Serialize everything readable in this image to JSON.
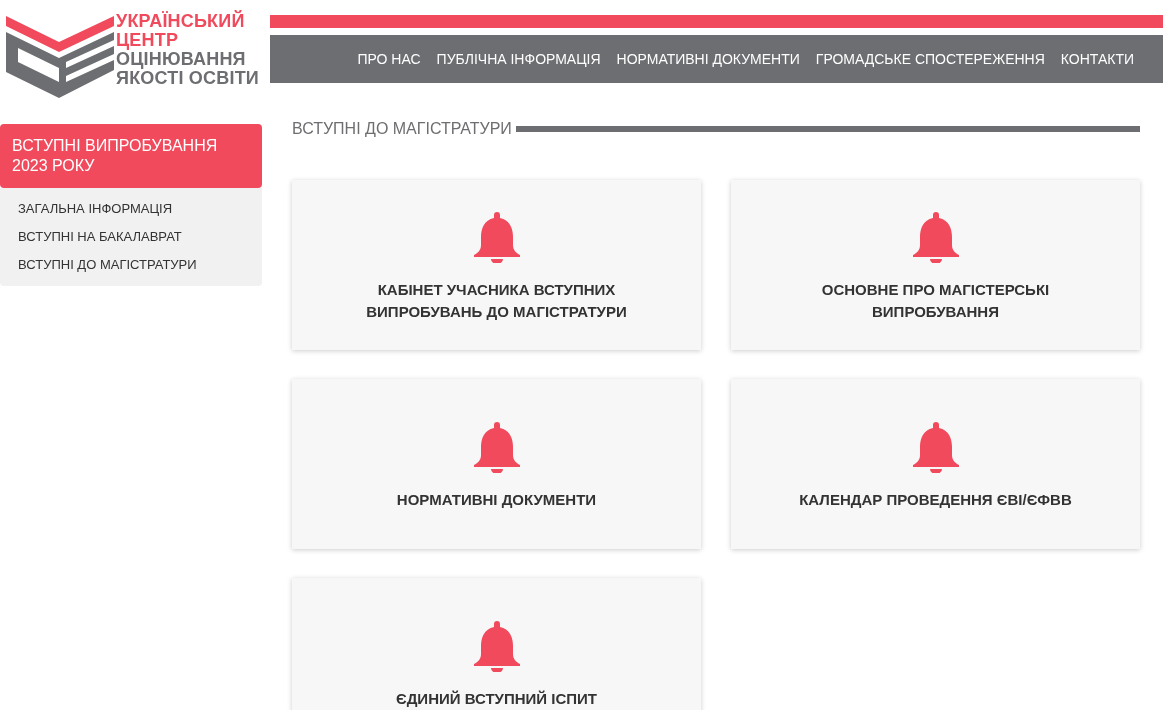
{
  "logo": {
    "lines": [
      "УКРАЇНСЬКИЙ",
      "ЦЕНТР",
      "ОЦІНЮВАННЯ",
      "ЯКОСТІ ОСВІТИ"
    ]
  },
  "nav": [
    "ПРО НАС",
    "ПУБЛІЧНА ІНФОРМАЦІЯ",
    "НОРМАТИВНІ ДОКУМЕНТИ",
    "ГРОМАДСЬКЕ СПОСТЕРЕЖЕННЯ",
    "КОНТАКТИ"
  ],
  "sidebar": {
    "title": "ВСТУПНІ ВИПРОБУВАННЯ 2023 РОКУ",
    "items": [
      "ЗАГАЛЬНА ІНФОРМАЦІЯ",
      "ВСТУПНІ НА БАКАЛАВРАТ",
      "ВСТУПНІ ДО МАГІСТРАТУРИ"
    ]
  },
  "heading": "ВСТУПНІ ДО МАГІСТРАТУРИ",
  "cards": [
    "КАБІНЕТ УЧАСНИКА ВСТУПНИХ ВИПРОБУВАНЬ ДО МАГІСТРАТУРИ",
    "ОСНОВНЕ ПРО МАГІСТЕРСЬКІ ВИПРОБУВАННЯ",
    "НОРМАТИВНІ ДОКУМЕНТИ",
    "КАЛЕНДАР ПРОВЕДЕННЯ ЄВІ/ЄФВВ",
    "ЄДИНИЙ ВСТУПНИЙ ІСПИТ"
  ]
}
